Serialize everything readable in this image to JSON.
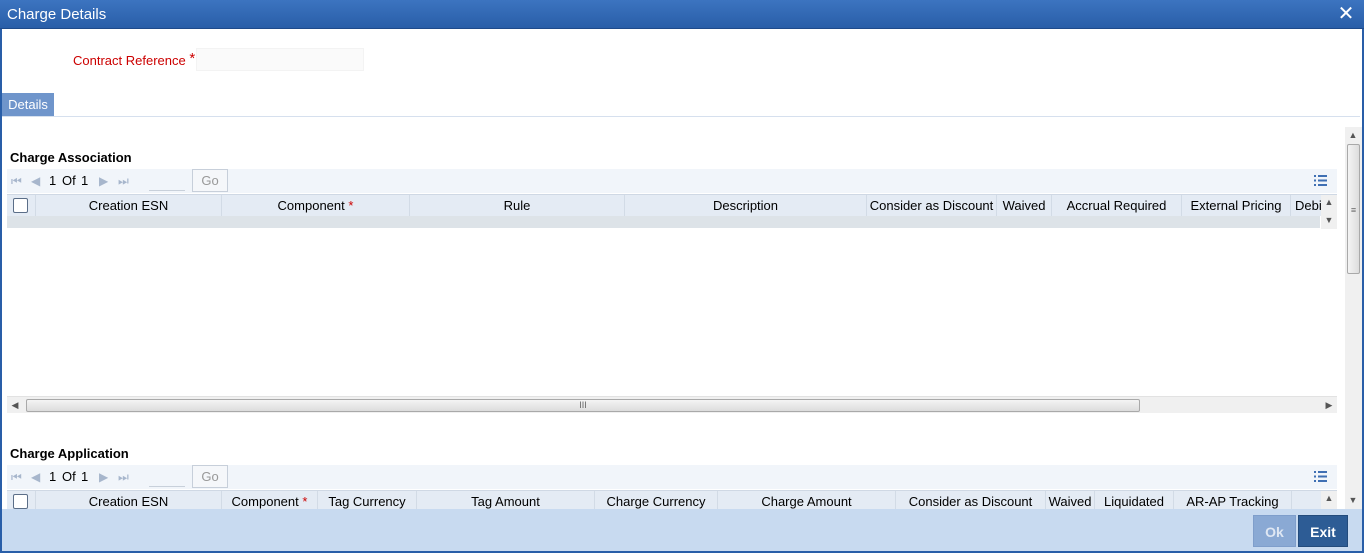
{
  "window": {
    "title": "Charge Details",
    "close_glyph": "✕"
  },
  "form": {
    "contract_reference_label": "Contract Reference",
    "required_marker": "*",
    "contract_reference_value": ""
  },
  "tabs": [
    {
      "label": "Details"
    }
  ],
  "charge_association": {
    "title": "Charge Association",
    "pager": {
      "current": "1",
      "of": "Of",
      "total": "1",
      "go_label": "Go"
    },
    "columns": [
      {
        "label": "Creation ESN",
        "required": false
      },
      {
        "label": "Component",
        "required": true
      },
      {
        "label": "Rule",
        "required": false
      },
      {
        "label": "Description",
        "required": false
      },
      {
        "label": "Consider as Discount",
        "required": false
      },
      {
        "label": "Waived",
        "required": false
      },
      {
        "label": "Accrual Required",
        "required": false
      },
      {
        "label": "External Pricing",
        "required": false
      },
      {
        "label": "Debi",
        "required": false
      }
    ]
  },
  "charge_application": {
    "title": "Charge Application",
    "pager": {
      "current": "1",
      "of": "Of",
      "total": "1",
      "go_label": "Go"
    },
    "columns": [
      {
        "label": "Creation ESN",
        "required": false
      },
      {
        "label": "Component",
        "required": true
      },
      {
        "label": "Tag Currency",
        "required": false
      },
      {
        "label": "Tag Amount",
        "required": false
      },
      {
        "label": "Charge Currency",
        "required": false
      },
      {
        "label": "Charge Amount",
        "required": false
      },
      {
        "label": "Consider as Discount",
        "required": false
      },
      {
        "label": "Waived",
        "required": false
      },
      {
        "label": "Liquidated",
        "required": false
      },
      {
        "label": "AR-AP Tracking",
        "required": false
      }
    ]
  },
  "scrollbar": {
    "grip": "III",
    "grip_vertical": "≡"
  },
  "footer": {
    "ok_label": "Ok",
    "exit_label": "Exit"
  },
  "icons": {
    "first": "first-page-icon",
    "prev": "previous-page-icon",
    "next": "next-page-icon",
    "last": "last-page-icon",
    "list": "list-view-icon"
  },
  "colors": {
    "titlebar": "#295ea8",
    "accent": "#6f95cb",
    "required": "#cc0000",
    "footer": "#c8daf0",
    "exit_button": "#2d5c95"
  }
}
